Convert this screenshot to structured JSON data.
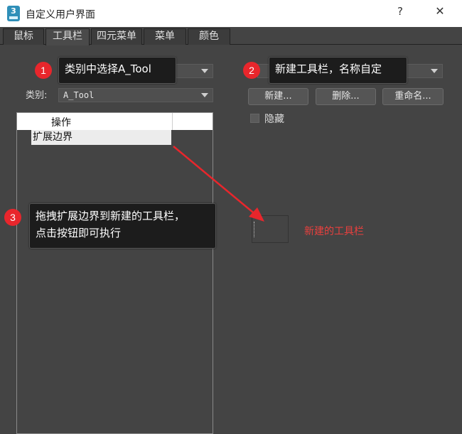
{
  "window": {
    "title": "自定义用户界面",
    "help": "?",
    "close": "✕",
    "app_icon_text": "3"
  },
  "tabs": [
    {
      "label": "鼠标",
      "active": false
    },
    {
      "label": "工具栏",
      "active": true
    },
    {
      "label": "四元菜单",
      "active": false
    },
    {
      "label": "菜单",
      "active": false
    },
    {
      "label": "颜色",
      "active": false
    }
  ],
  "left": {
    "group_combo_value": "",
    "category_label": "类别:",
    "category_value": "A_Tool",
    "list_header": "操作",
    "list_items": [
      "扩展边界"
    ]
  },
  "right": {
    "toolbar_combo_value": "",
    "buttons": {
      "new": "新建...",
      "delete": "删除...",
      "rename": "重命名..."
    },
    "hide_label": "隐藏",
    "hide_checked": false,
    "new_toolbar_label": "新建的工具栏"
  },
  "callouts": [
    {
      "number": "1",
      "text": "类别中选择A_Tool"
    },
    {
      "number": "2",
      "text": "新建工具栏，名称自定"
    },
    {
      "number": "3",
      "line1": "拖拽扩展边界到新建的工具栏，",
      "line2": "点击按钮即可执行"
    }
  ],
  "colors": {
    "accent_red": "#e8262c",
    "annotation_red": "#e8403e",
    "background": "#444444"
  }
}
